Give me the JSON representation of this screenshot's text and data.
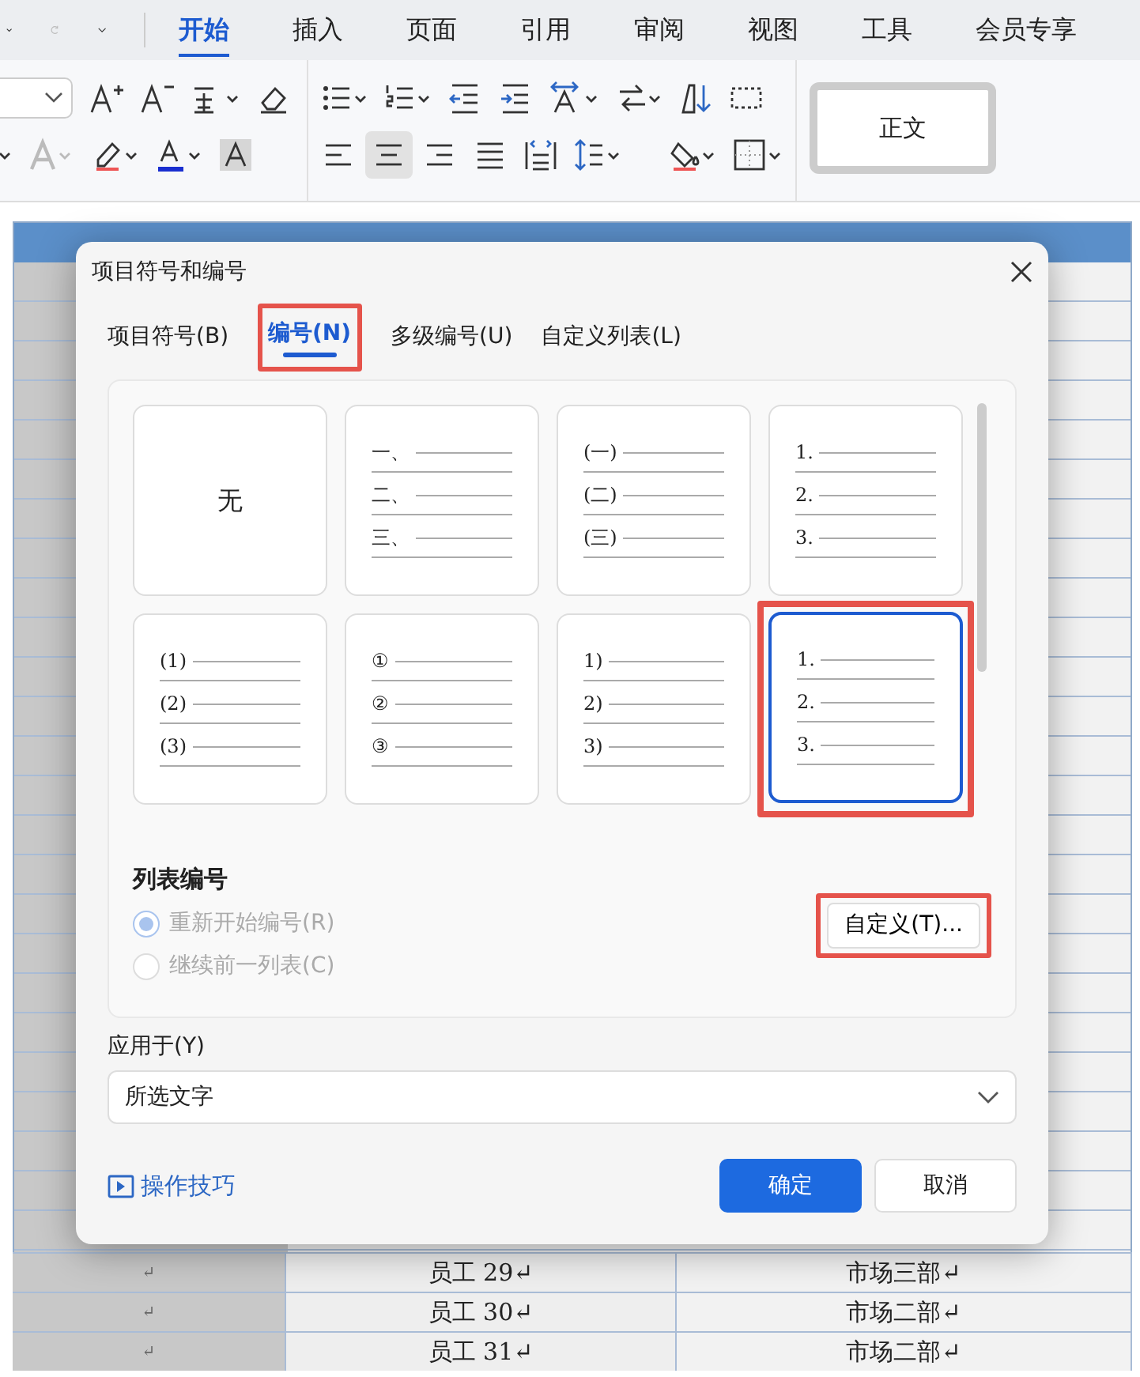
{
  "ribbon_tabs": [
    {
      "label": "开始",
      "selected": true
    },
    {
      "label": "插入",
      "selected": false
    },
    {
      "label": "页面",
      "selected": false
    },
    {
      "label": "引用",
      "selected": false
    },
    {
      "label": "审阅",
      "selected": false
    },
    {
      "label": "视图",
      "selected": false
    },
    {
      "label": "工具",
      "selected": false
    },
    {
      "label": "会员专享",
      "selected": false
    }
  ],
  "style_box": {
    "label": "正文"
  },
  "table": {
    "rows": [
      [
        "↵",
        "员工 29↵",
        "市场三部↵"
      ],
      [
        "↵",
        "员工 30↵",
        "市场二部↵"
      ],
      [
        "↵",
        "员工 31↵",
        "市场二部↵"
      ]
    ]
  },
  "dialog": {
    "title": "项目符号和编号",
    "tabs": [
      {
        "label": "项目符号(B)",
        "selected": false,
        "highlighted": false
      },
      {
        "label": "编号(N)",
        "selected": true,
        "highlighted": true
      },
      {
        "label": "多级编号(U)",
        "selected": false,
        "highlighted": false
      },
      {
        "label": "自定义列表(L)",
        "selected": false,
        "highlighted": false
      }
    ],
    "presets": [
      {
        "kind": "none",
        "label": "无",
        "selected": false,
        "highlighted": false
      },
      {
        "kind": "list",
        "markers": [
          "一、",
          "二、",
          "三、"
        ],
        "selected": false,
        "highlighted": false
      },
      {
        "kind": "list",
        "markers": [
          "(一)",
          "(二)",
          "(三)"
        ],
        "selected": false,
        "highlighted": false
      },
      {
        "kind": "list",
        "markers": [
          "1.",
          "2.",
          "3."
        ],
        "selected": false,
        "highlighted": false
      },
      {
        "kind": "list",
        "markers": [
          "(1)",
          "(2)",
          "(3)"
        ],
        "selected": false,
        "highlighted": false
      },
      {
        "kind": "list",
        "markers": [
          "①",
          "②",
          "③"
        ],
        "selected": false,
        "highlighted": false
      },
      {
        "kind": "list",
        "markers": [
          "1)",
          "2)",
          "3)"
        ],
        "selected": false,
        "highlighted": false
      },
      {
        "kind": "list",
        "markers": [
          "1.",
          "2.",
          "3."
        ],
        "selected": true,
        "highlighted": true
      }
    ],
    "section_title": "列表编号",
    "options": [
      {
        "label": "重新开始编号(R)",
        "selected": true,
        "disabled": true
      },
      {
        "label": "继续前一列表(C)",
        "selected": false,
        "disabled": true
      }
    ],
    "customize_button": {
      "label": "自定义(T)...",
      "highlighted": true
    },
    "apply_to": {
      "label": "应用于(Y)",
      "value": "所选文字"
    },
    "tips_link": {
      "label": "操作技巧"
    },
    "buttons": [
      {
        "label": "确定",
        "kind": "primary"
      },
      {
        "label": "取消",
        "kind": "secondary"
      }
    ]
  }
}
